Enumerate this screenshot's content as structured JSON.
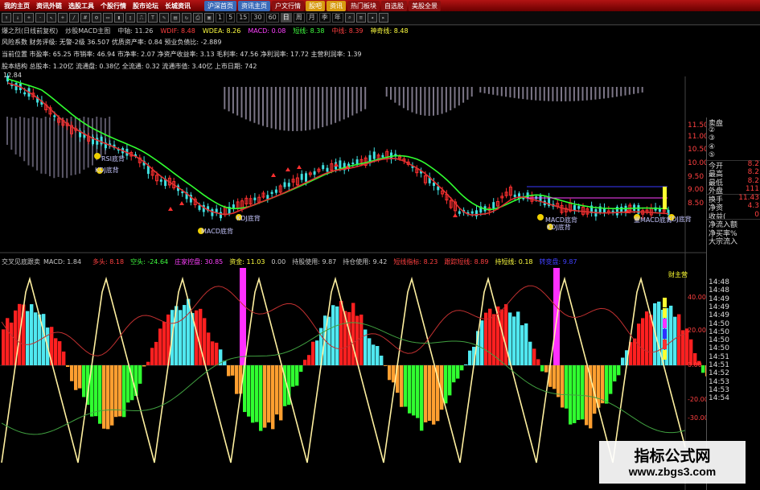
{
  "menubar": {
    "items": [
      "我的主页",
      "资讯外链",
      "选股工具",
      "个股行情",
      "股市论坛",
      "长城资讯"
    ],
    "tabs": [
      {
        "label": "沪深首页",
        "color": "#3a6ab8"
      },
      {
        "label": "资讯主页",
        "color": "#3a6ab8"
      },
      {
        "label": "户文行情",
        "color": "#8a1010"
      },
      {
        "label": "股吧",
        "color": "#d89a10"
      },
      {
        "label": "资讯",
        "color": "#d89a10"
      },
      {
        "label": "热门板块",
        "color": "#8a1010"
      },
      {
        "label": "自选股",
        "color": "#8a1010"
      },
      {
        "label": "美股全景",
        "color": "#8a1010"
      }
    ]
  },
  "toolbar": {
    "periods": [
      "1",
      "5",
      "15",
      "30",
      "60",
      "日",
      "周",
      "月",
      "季",
      "年"
    ],
    "active_period": "日"
  },
  "indicator_bar": {
    "segments": [
      {
        "text": "爆之烈(日线前复权)",
        "color": "#c8c8c8"
      },
      {
        "text": "炒股MACD主图",
        "color": "#c8c8c8"
      },
      {
        "text": "中轴: 11.26",
        "color": "#c8c8c8"
      },
      {
        "text": "WDIF: 8.48",
        "color": "#ff4040"
      },
      {
        "text": "WDEA: 8.26",
        "color": "#ffff40"
      },
      {
        "text": "MACD: 0.08",
        "color": "#ff40ff"
      },
      {
        "text": "短线: 8.38",
        "color": "#40ff40"
      },
      {
        "text": "中线: 8.39",
        "color": "#ff4040"
      },
      {
        "text": "神奇线: 8.48",
        "color": "#ffff40"
      }
    ]
  },
  "info_lines": [
    "风险系数 财务评级: 无警-2级 36.507 优质资产率: 0.84 预业负债比: -2.889",
    "当前位置 市盈率: 65.25 市销率: 46.94 市净率: 2.07 净资产收益率: 3.13 毛利率: 47.56 净利润率: 17.72 主营利润率: 1.39",
    "股本结构 总股本: 1.20亿 流通盘: 0.38亿 全流通: 0.32 流通市值: 3.40亿 上市日期: 742"
  ],
  "price_chart": {
    "high_label": "12.84",
    "annotations": [
      "RSI底背",
      "KDJ底背",
      "KDJ底背",
      "MACD底背",
      "MACD底背",
      "KDJ底背",
      "量MACD底背",
      "KDJ底背"
    ],
    "price_axis": [
      "11.50",
      "11.00",
      "10.50",
      "10.00",
      "9.50",
      "9.00",
      "8.50"
    ]
  },
  "indicator_panel": {
    "title": "交叉见底跟卖",
    "macd_label": "MACD: 1.84",
    "legend": [
      {
        "text": "多头: 8.18",
        "color": "#ff4040"
      },
      {
        "text": "空头: -24.64",
        "color": "#40ff40"
      },
      {
        "text": "庄家控盘: 30.85",
        "color": "#ff40ff"
      },
      {
        "text": "资金: 11.03",
        "color": "#ffff40"
      },
      {
        "text": "0.00",
        "color": "#c8c8c8"
      },
      {
        "text": "持股使用: 9.87",
        "color": "#c8c8c8"
      },
      {
        "text": "持仓使用: 9.42",
        "color": "#c8c8c8"
      },
      {
        "text": "短线指标: 8.23",
        "color": "#ff4040"
      },
      {
        "text": "跟踪短线: 8.89",
        "color": "#ff4040"
      },
      {
        "text": "持短线: 0.18",
        "color": "#ffff40"
      },
      {
        "text": "转变盘: 9.87",
        "color": "#4040ff"
      }
    ],
    "right_badge": "财主营",
    "axis": [
      "40.00",
      "20.00",
      "0.00",
      "-20.00",
      "-30.00"
    ]
  },
  "quote_panel": {
    "rows": [
      {
        "label": "卖盘",
        "value": ""
      },
      {
        "label": "②",
        "value": ""
      },
      {
        "label": "③",
        "value": ""
      },
      {
        "label": "④",
        "value": ""
      },
      {
        "label": "⑤",
        "value": ""
      },
      {
        "label": "今开",
        "value": "8.2"
      },
      {
        "label": "最高",
        "value": "8.2"
      },
      {
        "label": "最低",
        "value": "8.2"
      },
      {
        "label": "外盘",
        "value": "111"
      },
      {
        "label": "换手",
        "value": "11.43"
      },
      {
        "label": "净资",
        "value": "4.3"
      },
      {
        "label": "收益(",
        "value": "0"
      },
      {
        "label": "净流入额",
        "value": ""
      },
      {
        "label": "净买率%",
        "value": ""
      },
      {
        "label": "大宗流入",
        "value": ""
      }
    ],
    "times": [
      "14:48",
      "14:48",
      "14:49",
      "14:49",
      "14:49",
      "14:50",
      "14:50",
      "14:50",
      "14:50",
      "14:51",
      "14:51",
      "14:52",
      "14:53",
      "14:53",
      "14:54"
    ]
  },
  "watermark": {
    "title": "指标公式网",
    "url": "www.zbgs3.com"
  },
  "colors": {
    "candle_up": "#ff3030",
    "candle_down": "#40e0e0",
    "bar_green": "#30ff30",
    "bar_orange": "#ff9f30",
    "bar_cyan": "#50e8f0",
    "bar_red": "#ff2020",
    "magenta": "#ff30ff",
    "yellow_line": "#fff0a0",
    "green_line": "#30ff30"
  }
}
